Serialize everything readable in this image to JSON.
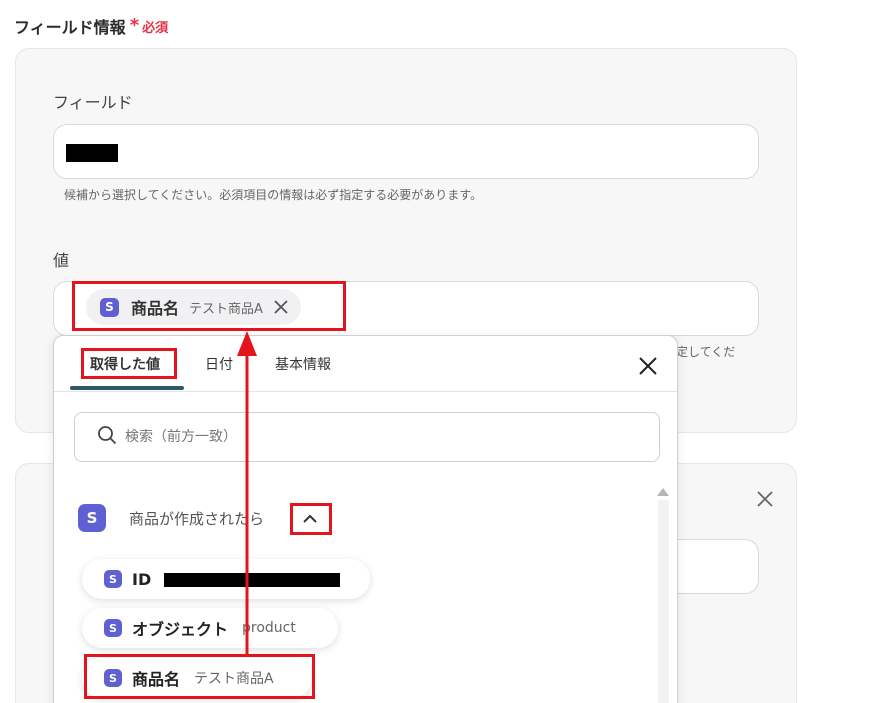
{
  "section": {
    "title": "フィールド情報",
    "required_label": "必須"
  },
  "field": {
    "label": "フィールド",
    "hint": "候補から選択してください。必須項目の情報は必ず指定する必要があります。"
  },
  "value": {
    "label": "値",
    "chip": {
      "name": "商品名",
      "value": "テスト商品A"
    },
    "hint_tail": "定してくだ"
  },
  "dropdown": {
    "tabs": [
      {
        "label": "取得した値"
      },
      {
        "label": "日付"
      },
      {
        "label": "基本情報"
      }
    ],
    "search_placeholder": "検索（前方一致）",
    "group_title": "商品が作成されたら",
    "items": [
      {
        "name": "ID",
        "value": ""
      },
      {
        "name": "オブジェクト",
        "value": "product"
      },
      {
        "name": "商品名",
        "value": "テスト商品A"
      }
    ]
  },
  "icons": {
    "badge_letter": "S"
  },
  "colors": {
    "accent": "#e3141e",
    "badge": "#5f60d1",
    "tab_underline": "#2d5a69",
    "required": "#e5334a"
  }
}
